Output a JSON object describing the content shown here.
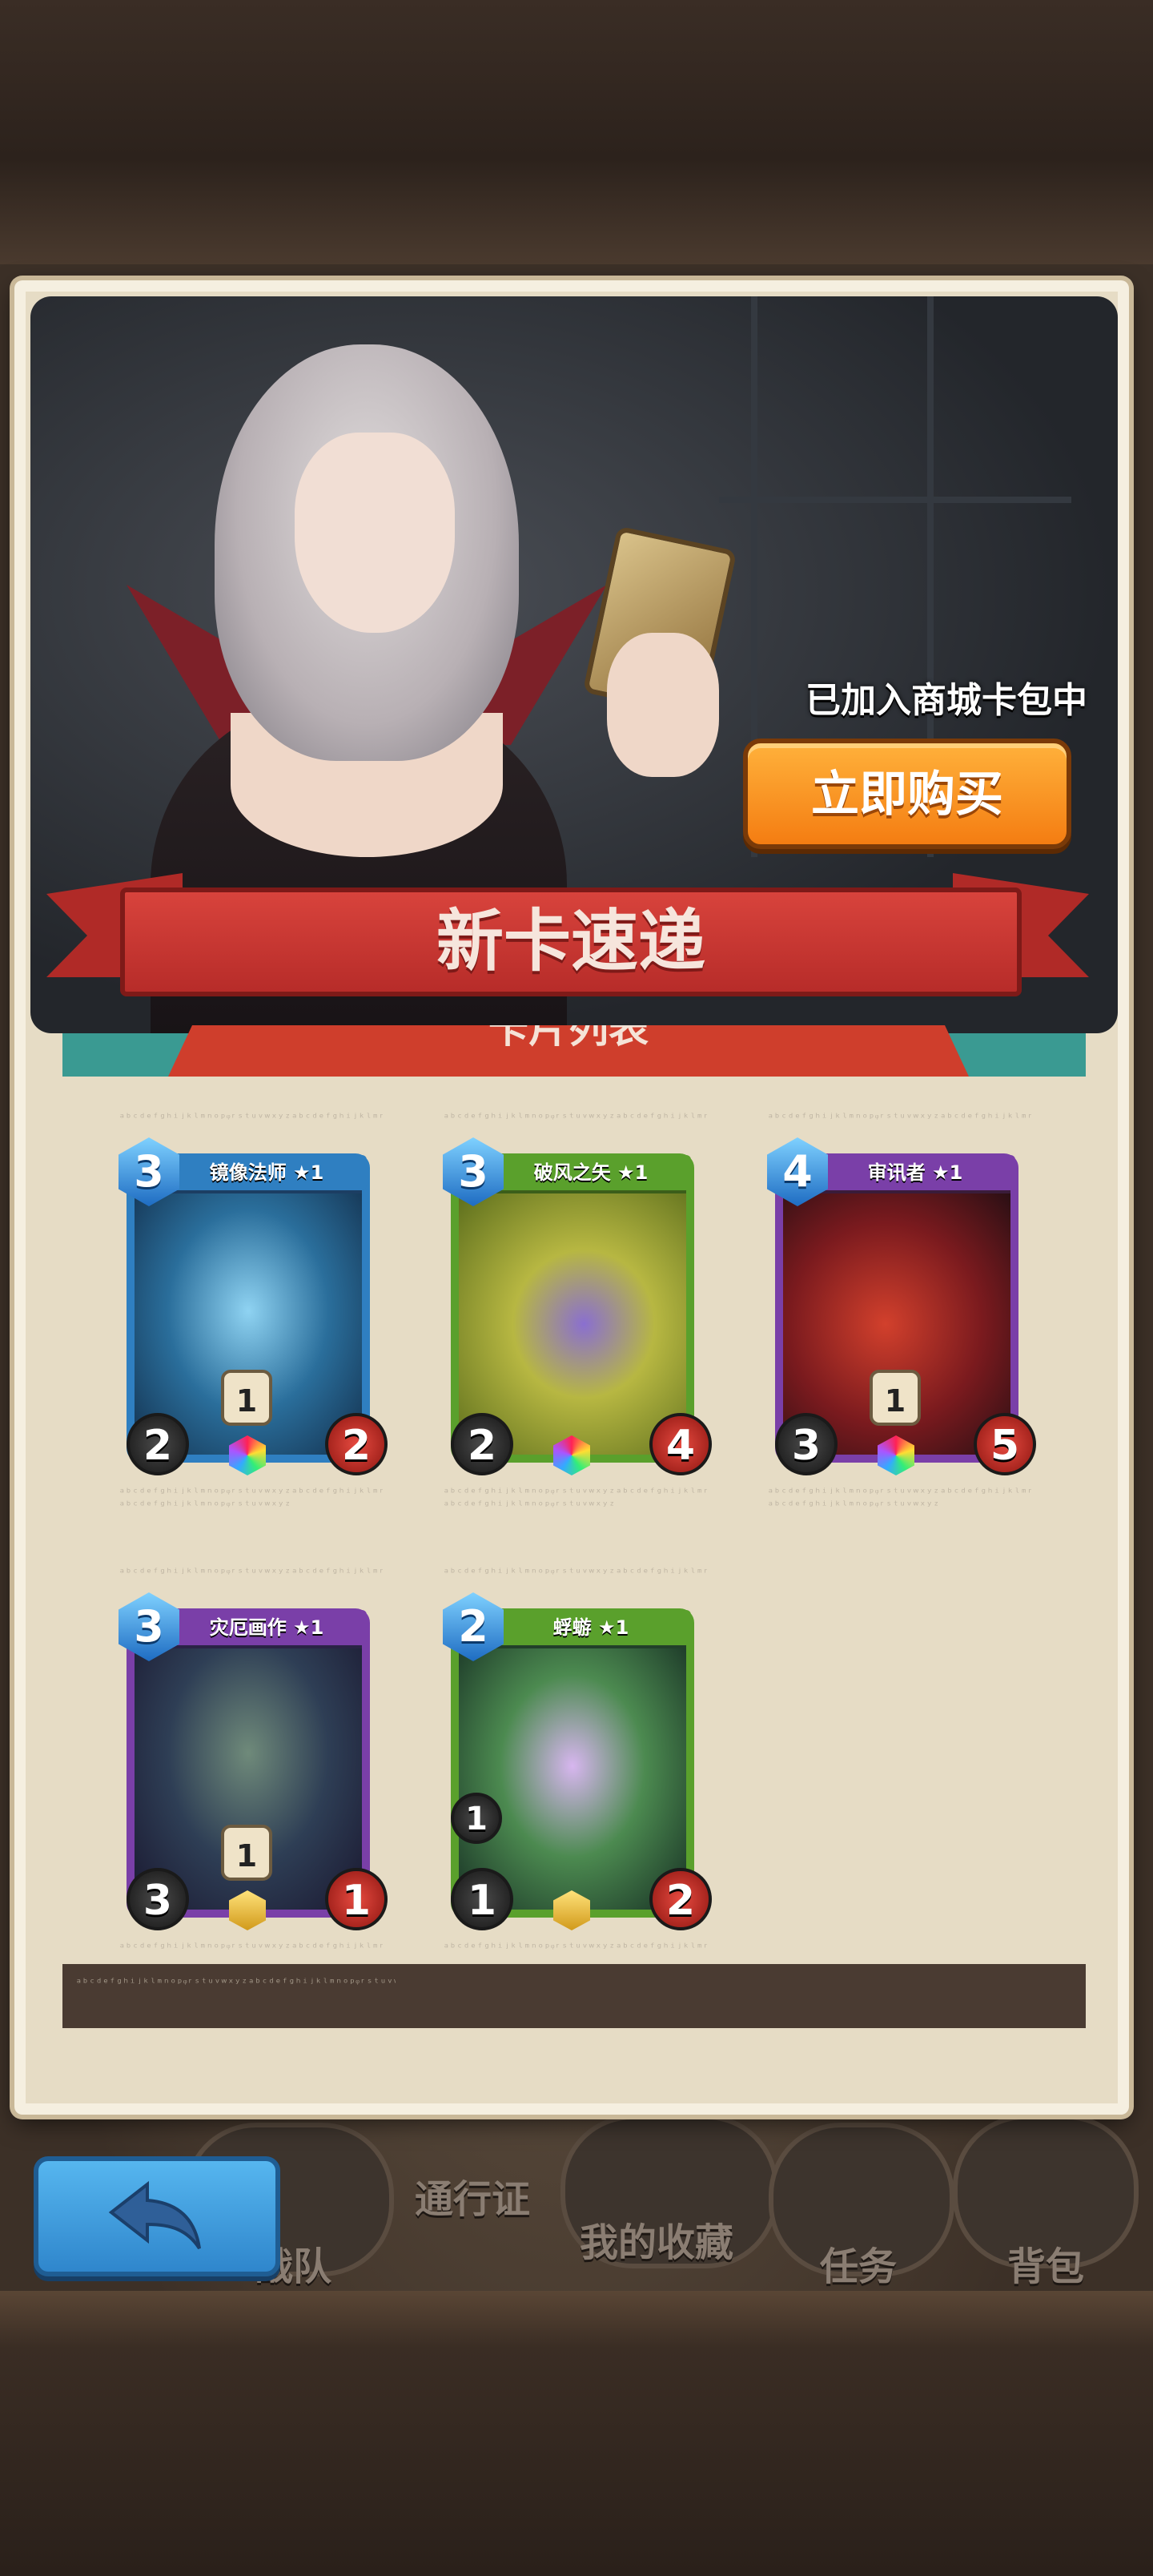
{
  "banner": {
    "added_text": "已加入商城卡包中",
    "buy_label": "立即购买",
    "ribbon_title": "新卡速递"
  },
  "list": {
    "header": "卡片列表"
  },
  "cards": [
    {
      "name": "镜像法师 ★1",
      "cost": "3",
      "attack": "2",
      "health": "2",
      "mid": "1",
      "theme": "blue",
      "rarity": "rainbow"
    },
    {
      "name": "破风之矢 ★1",
      "cost": "3",
      "attack": "2",
      "health": "4",
      "mid": "",
      "theme": "green",
      "rarity": "rainbow"
    },
    {
      "name": "审讯者 ★1",
      "cost": "4",
      "attack": "3",
      "health": "5",
      "mid": "1",
      "theme": "purple",
      "rarity": "rainbow"
    },
    {
      "name": "灾厄画作 ★1",
      "cost": "3",
      "attack": "3",
      "health": "1",
      "mid": "1",
      "theme": "purple",
      "rarity": "gold"
    },
    {
      "name": "蜉蝣 ★1",
      "cost": "2",
      "attack": "1",
      "health": "2",
      "mid": "1",
      "theme": "green",
      "rarity": "gold"
    }
  ],
  "nav": {
    "items": [
      "战队",
      "通行证",
      "我的收藏",
      "任务",
      "背包"
    ]
  },
  "colors": {
    "blue_frame": "#2f7fc1",
    "green_frame": "#5aa02c",
    "purple_frame": "#7a3fa8",
    "buy_orange": "#f47d12",
    "ribbon_red": "#c8352f"
  }
}
